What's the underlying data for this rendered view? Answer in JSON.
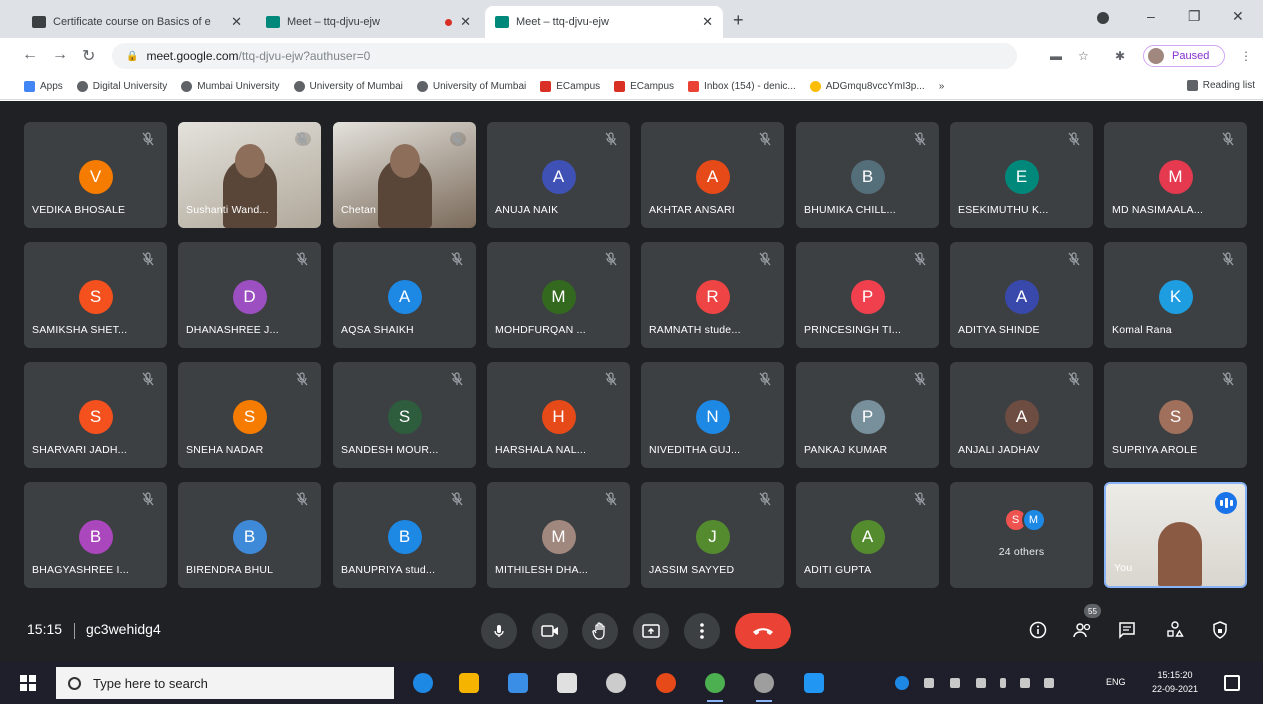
{
  "browser": {
    "tabs": [
      {
        "title": "Certificate course on Basics of e",
        "favicon_color": "#3c4043",
        "active": false,
        "recording": false
      },
      {
        "title": "Meet – ttq-djvu-ejw",
        "favicon_color": "#00897b",
        "active": false,
        "recording": true
      },
      {
        "title": "Meet – ttq-djvu-ejw",
        "favicon_color": "#00897b",
        "active": true,
        "recording": false
      }
    ],
    "new_tab": "+",
    "window_controls": [
      "–",
      "❐",
      "✕"
    ],
    "url_host": "meet.google.com",
    "url_path": "/ttq-djvu-ejw?authuser=0",
    "profile_status": "Paused",
    "bookmarks": [
      {
        "label": "Apps",
        "color": "#4285f4"
      },
      {
        "label": "Digital University",
        "color": "#5f6368"
      },
      {
        "label": "Mumbai University",
        "color": "#5f6368"
      },
      {
        "label": "University of Mumbai",
        "color": "#5f6368"
      },
      {
        "label": "University of Mumbai",
        "color": "#5f6368"
      },
      {
        "label": "ECampus",
        "color": "#d93025"
      },
      {
        "label": "ECampus",
        "color": "#d93025"
      },
      {
        "label": "Inbox (154) - denic...",
        "color": "#ea4335"
      },
      {
        "label": "ADGmqu8vccYmI3p...",
        "color": "#fbbc04"
      }
    ],
    "bookmarks_more": "»",
    "reading_list": "Reading list"
  },
  "meet": {
    "tiles": [
      {
        "name": "VEDIKA BHOSALE",
        "initial": "V",
        "color": "#f57c00"
      },
      {
        "name": "Sushanti Wand...",
        "initial": "",
        "color": "#b0a89a",
        "video": true
      },
      {
        "name": "Chetan",
        "initial": "",
        "color": "#7a6a5a",
        "video": true
      },
      {
        "name": "ANUJA NAIK",
        "initial": "A",
        "color": "#3f51b5"
      },
      {
        "name": "AKHTAR ANSARI",
        "initial": "A",
        "color": "#e64a19"
      },
      {
        "name": "BHUMIKA CHILL...",
        "initial": "B",
        "color": "#546e7a"
      },
      {
        "name": "ESEKIMUTHU K...",
        "initial": "E",
        "color": "#00897b"
      },
      {
        "name": "MD NASIMAALA...",
        "initial": "M",
        "color": "#e53950"
      },
      {
        "name": "SAMIKSHA SHET...",
        "initial": "S",
        "color": "#f4511e"
      },
      {
        "name": "DHANASHREE J...",
        "initial": "D",
        "color": "#9c4fc1"
      },
      {
        "name": "AQSA SHAIKH",
        "initial": "A",
        "color": "#1e88e5"
      },
      {
        "name": "MOHDFURQAN ...",
        "initial": "M",
        "color": "#33691e"
      },
      {
        "name": "RAMNATH stude...",
        "initial": "R",
        "color": "#ef4444"
      },
      {
        "name": "PRINCESINGH TI...",
        "initial": "P",
        "color": "#f0404e"
      },
      {
        "name": "ADITYA SHINDE",
        "initial": "A",
        "color": "#3949ab"
      },
      {
        "name": "Komal Rana",
        "initial": "K",
        "color": "#1e9ee0"
      },
      {
        "name": "SHARVARI JADH...",
        "initial": "S",
        "color": "#f4511e"
      },
      {
        "name": "SNEHA NADAR",
        "initial": "S",
        "color": "#f57c00"
      },
      {
        "name": "SANDESH MOUR...",
        "initial": "S",
        "color": "#2e5d3e"
      },
      {
        "name": "HARSHALA NAL...",
        "initial": "H",
        "color": "#e64a19"
      },
      {
        "name": "NIVEDITHA GUJ...",
        "initial": "N",
        "color": "#1e88e5"
      },
      {
        "name": "PANKAJ KUMAR",
        "initial": "P",
        "color": "#78909c"
      },
      {
        "name": "ANJALI JADHAV",
        "initial": "A",
        "color": "#6d4c41"
      },
      {
        "name": "SUPRIYA AROLE",
        "initial": "S",
        "color": "#a1705c"
      },
      {
        "name": "BHAGYASHREE I...",
        "initial": "B",
        "color": "#ab47bc"
      },
      {
        "name": "BIRENDRA BHUL",
        "initial": "B",
        "color": "#3f8ad8"
      },
      {
        "name": "BANUPRIYA stud...",
        "initial": "B",
        "color": "#1e88e5"
      },
      {
        "name": "MITHILESH DHA...",
        "initial": "M",
        "color": "#a1887f"
      },
      {
        "name": "JASSIM SAYYED",
        "initial": "J",
        "color": "#558b2f"
      },
      {
        "name": "ADITI GUPTA",
        "initial": "A",
        "color": "#558b2f"
      }
    ],
    "others": {
      "label": "24 others",
      "initials": [
        "S",
        "M"
      ],
      "colors": [
        "#ef5350",
        "#1e88e5"
      ]
    },
    "self_label": "You",
    "clock": "15:15",
    "meeting_code": "gc3wehidg4",
    "participant_count": "55",
    "colors": {
      "stage": "#202124",
      "tile": "#3c4043",
      "end_call": "#ea4335",
      "accent": "#8ab4f8"
    }
  },
  "taskbar": {
    "search_placeholder": "Type here to search",
    "time": "15:15:20",
    "date": "22-09-2021",
    "lang": "ENG"
  }
}
